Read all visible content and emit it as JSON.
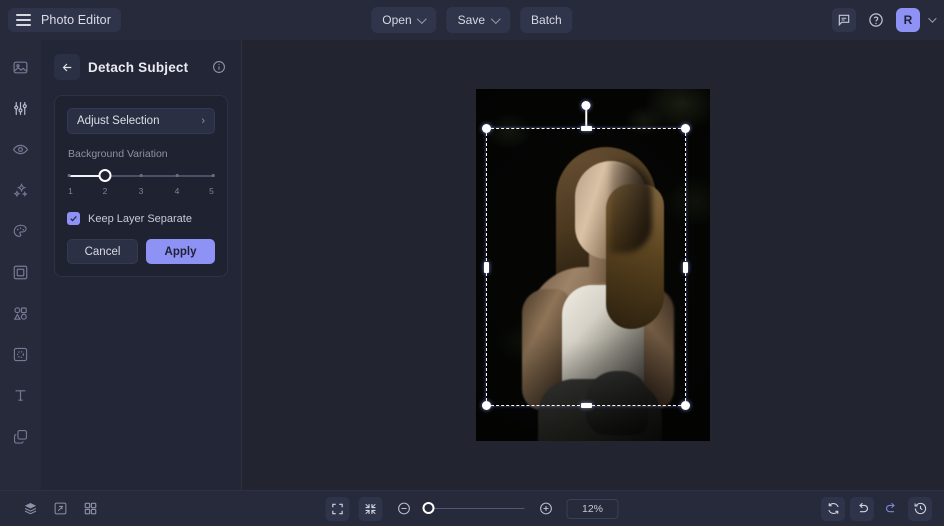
{
  "app": {
    "brand": "Photo Editor",
    "accent_color": "#8f92f5",
    "topbar_bg": "#272a3a",
    "panel_bg": "#232636",
    "canvas_bg": "#22252f"
  },
  "topbar": {
    "menu_icon": "hamburger-menu-icon",
    "buttons": [
      {
        "label": "Open",
        "has_chevron": true
      },
      {
        "label": "Save",
        "has_chevron": true
      },
      {
        "label": "Batch",
        "has_chevron": false
      }
    ],
    "right": {
      "comment_icon": "comment-icon",
      "help_icon": "help-circle-icon",
      "avatar_initial": "R",
      "avatar_chevron": "chevron-down-icon"
    }
  },
  "rail": {
    "items": [
      {
        "name": "image-icon",
        "label": "Image"
      },
      {
        "name": "adjustments-icon",
        "label": "Adjust"
      },
      {
        "name": "eye-icon",
        "label": "Preview"
      },
      {
        "name": "sparkles-icon",
        "label": "Effects"
      },
      {
        "name": "palette-icon",
        "label": "Color"
      },
      {
        "name": "frame-icon",
        "label": "Frame"
      },
      {
        "name": "shapes-icon",
        "label": "Shapes"
      },
      {
        "name": "pattern-icon",
        "label": "Pattern"
      },
      {
        "name": "text-icon",
        "label": "Text"
      },
      {
        "name": "layers-icon",
        "label": "Layers"
      }
    ]
  },
  "panel": {
    "back_icon": "arrow-left-icon",
    "title": "Detach Subject",
    "info_icon": "info-circle-icon",
    "adjust_selection": {
      "label": "Adjust Selection",
      "arrow": "chevron-right-icon"
    },
    "slider": {
      "label": "Background Variation",
      "value": 2,
      "min": 1,
      "max": 5,
      "ticks": [
        "1",
        "2",
        "3",
        "4",
        "5"
      ]
    },
    "checkbox": {
      "label": "Keep Layer Separate",
      "checked": true
    },
    "cancel_label": "Cancel",
    "apply_label": "Apply"
  },
  "canvas": {
    "image_alt": "Portrait of a woman seated in dramatic low light against a dark background",
    "selection": {
      "handles": [
        "top-left",
        "top-center",
        "top-right",
        "middle-left",
        "middle-right",
        "bottom-left",
        "bottom-center",
        "bottom-right"
      ],
      "rotate_handle": "rotate-handle"
    }
  },
  "bottombar": {
    "left_tools": [
      {
        "name": "layers-stack-icon",
        "label": "Layers"
      },
      {
        "name": "compare-icon",
        "label": "Compare"
      },
      {
        "name": "grid-icon",
        "label": "Grid"
      }
    ],
    "view_tools": [
      {
        "name": "fit-screen-icon",
        "label": "Fit to screen"
      },
      {
        "name": "fit-content-icon",
        "label": "Fit content"
      }
    ],
    "zoom_out_icon": "zoom-out-icon",
    "zoom_in_icon": "zoom-in-icon",
    "zoom_level": "12%",
    "right_tools": [
      {
        "name": "reset-icon",
        "label": "Reset"
      },
      {
        "name": "undo-icon",
        "label": "Undo"
      },
      {
        "name": "redo-icon",
        "label": "Redo"
      },
      {
        "name": "history-icon",
        "label": "History"
      }
    ]
  }
}
